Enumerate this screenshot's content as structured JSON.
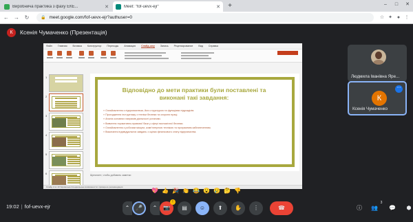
{
  "browser": {
    "tabs": [
      {
        "title": "Виробнича практика з фаху ЕКЕ...",
        "favicon_color": "#34a853",
        "active": false
      },
      {
        "title": "Meet: \"fof-uevx-ejr\"",
        "favicon_color": "#00897b",
        "active": true
      }
    ],
    "new_tab": "+",
    "url": "meet.google.com/fof-uevx-ejr?authuser=0",
    "nav": {
      "back": "←",
      "forward": "→",
      "reload": "↻"
    },
    "window_controls": {
      "minimize": "–",
      "maximize": "□",
      "close": "✕"
    }
  },
  "presenter": {
    "avatar_letter": "К",
    "label": "Ксенія Чумаченко (Презентація)"
  },
  "slideshow": {
    "ribbon_tabs": [
      "Файл",
      "Главная",
      "Вставка",
      "Конструктор",
      "Переходы",
      "Анимация",
      "Слайд-шоу",
      "Запись",
      "Рецензирование",
      "Вид",
      "Справка"
    ],
    "active_ribbon_tab": "Слайд-шоу",
    "thumb_numbers": [
      "1",
      "2",
      "3",
      "4",
      "5",
      "6"
    ],
    "slide_title": "Відповідно до мети практики були поставлені та виконані такі завдання:",
    "bullets": [
      "Ознайомлення з підприємством, його структурою та функціями підрозділів.",
      "Проходження інструктажу з техніки безпеки та охорони праці.",
      "Аналіз основних напрямів діяльності установи.",
      "Вивчення нормативно-правової бази у сфері економічної безпеки.",
      "Ознайомлення з робочим місцем, комп'ютерною технікою та програмним забезпеченням.",
      "Виконання індивідуальних завдань з оцінки фінансового стану підприємства."
    ],
    "notes_placeholder": "Щелкните, чтобы добавить заметки",
    "status_text": "Слайд 2 из 10   Українська   Специальные возможности: проверьте рекомендации"
  },
  "participants": [
    {
      "name": "Людмила Іванівна Яре...",
      "avatar": "photo"
    },
    {
      "name": "Ксенія Чумаченко",
      "avatar_letter": "К",
      "avatar_color": "#e37400",
      "more_icon": "⋯"
    }
  ],
  "reactions": [
    "💖",
    "👍",
    "🎉",
    "👏",
    "😂",
    "😮",
    "😢",
    "🤔",
    "👎"
  ],
  "meeting": {
    "time": "19:02",
    "code": "fof-uevx-ejr"
  },
  "controls": {
    "chevron": "⌃",
    "mic": "🎤",
    "cam_chevron": "⌃",
    "cam": "📷",
    "captions": "▤",
    "emoji": "☺",
    "present": "⬆",
    "raise_hand": "✋",
    "more": "⋮",
    "end_call": "☎",
    "cam_badge": "!"
  },
  "right_controls": {
    "info": "ⓘ",
    "people": "👥",
    "people_count": "3",
    "chat": "💬",
    "activities": "⬢"
  },
  "colors": {
    "accent_olive": "#a8a83e",
    "bullet_text": "#b05e3a",
    "end_call_red": "#ea4335",
    "active_blue": "#8ab4f8"
  }
}
